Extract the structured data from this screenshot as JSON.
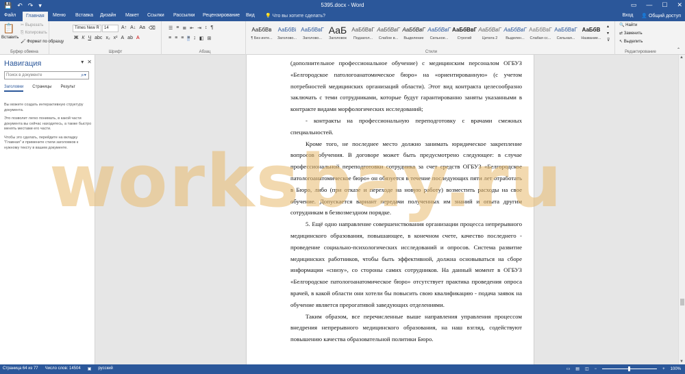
{
  "window": {
    "title": "5395.docx - Word",
    "quick_access": [
      "💾",
      "↶",
      "↷",
      "▾"
    ]
  },
  "tabs": {
    "items": [
      "Файл",
      "Главная",
      "Меню",
      "Вставка",
      "Дизайн",
      "Макет",
      "Ссылки",
      "Рассылки",
      "Рецензирование",
      "Вид"
    ],
    "active": "Главная",
    "tell_me": "Что вы хотите сделать?",
    "sign_in": "Вход",
    "share": "Общий доступ"
  },
  "ribbon": {
    "clipboard": {
      "paste": "Вставить",
      "cut": "Вырезать",
      "copy": "Копировать",
      "format_painter": "Формат по образцу",
      "label": "Буфер обмена"
    },
    "font": {
      "name": "Times New R",
      "size": "14",
      "label": "Шрифт"
    },
    "paragraph": {
      "label": "Абзац"
    },
    "styles": {
      "label": "Стили",
      "items": [
        {
          "preview": "АаБбВв",
          "name": "¶ Без инте..."
        },
        {
          "preview": "АаБбВі",
          "name": "Заголово..."
        },
        {
          "preview": "АаБбВвГ",
          "name": "Заголово..."
        },
        {
          "preview": "АаБ",
          "name": "Заголовок"
        },
        {
          "preview": "АаБбВвГ",
          "name": "Подзагол..."
        },
        {
          "preview": "АаБбВвГ",
          "name": "Слабое в..."
        },
        {
          "preview": "АаБбВвГ",
          "name": "Выделение"
        },
        {
          "preview": "АаБбВвГ",
          "name": "Сильное..."
        },
        {
          "preview": "АаБбВвГ",
          "name": "Строгий"
        },
        {
          "preview": "АаБбВвГ",
          "name": "Цитата 2"
        },
        {
          "preview": "АаБбВвГ",
          "name": "Выделен..."
        },
        {
          "preview": "АаБбВвГ",
          "name": "Слабая сс..."
        },
        {
          "preview": "АаБбВвГ",
          "name": "Сильная..."
        },
        {
          "preview": "АаБбВ",
          "name": "Название..."
        }
      ]
    },
    "editing": {
      "find": "Найти",
      "replace": "Заменить",
      "select": "Выделить",
      "label": "Редактирование"
    }
  },
  "nav": {
    "title": "Навигация",
    "search_placeholder": "Поиск в документе",
    "tabs": [
      "Заголовки",
      "Страницы",
      "Результ"
    ],
    "help": [
      "Вы можете создать интерактивную структуру документа.",
      "Это позволит легко понимать, в какой части документа вы сейчас находитесь, а также быстро менять местами его части.",
      "Чтобы это сделать, перейдите на вкладку \"Главная\" и примените стили заголовков к нужному тексту в вашем документе."
    ]
  },
  "document": {
    "paragraphs": [
      {
        "indent": false,
        "text": "(дополнительное профессиональное обучение) с медицинским персоналом ОГБУЗ «Белгородское патологоанатомическое бюро» на «ориентированную» (с учетом потребностей медицинских организаций области). Этот вид контракта целесообразно заключать с теми сотрудниками, которые будут гарантированно заняты указанными в контракте видами морфологических исследований;"
      },
      {
        "indent": true,
        "text": "- контракты на профессиональную переподготовку с врачами смежных специальностей."
      },
      {
        "indent": true,
        "text": "Кроме того, не последнее место должно занимать юридическое закрепление вопросов обучения. В договоре может быть предусмотрено следующее: в случае профессиональной переподготовки сотрудника за счет средств ОГБУЗ «Белгородское патологоанатомическое бюро» он обязуется в течение последующих пяти лет отработать в Бюро, либо (при отказе и переходе на новую работу) возместить расходы на свое обучение. Допускается вариант передачи полученных им знаний и опыта другим сотрудникам в безвозмездном порядке."
      },
      {
        "indent": true,
        "text": "5. Ещё одно направление совершенствования организации процесса непрерывного медицинского образования, повышающее, в конечном счете, качество последнего - проведение социально-психологических исследований и опросов. Система развитие медицинских работников, чтобы быть эффективной, должна основываться на сборе информации «снизу», со стороны самих сотрудников. На данный момент в ОГБУЗ «Белгородское патологоанатомическое бюро» отсутствует практика проведения опроса врачей, в какой области они хотели бы повысить свою квалификацию - подача заявок на обучение является прерогативой заведующих отделениями."
      },
      {
        "indent": true,
        "text": "Таким образом, все перечисленные выше направления управления процессом внедрения непрерывного медицинского образования, на наш взгляд, содействуют повышению качества образовательной политики Бюро."
      }
    ],
    "watermark": "worksbay.ru"
  },
  "status": {
    "page": "Страница 64 из 77",
    "words": "Число слов: 14504",
    "language": "русский",
    "zoom_minus": "−",
    "zoom_plus": "+",
    "zoom": "100%"
  }
}
